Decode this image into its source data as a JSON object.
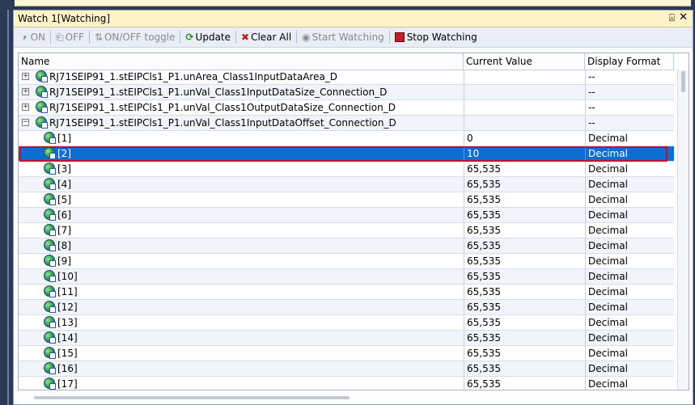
{
  "window": {
    "title": "Watch 1[Watching]",
    "pin": "⍓",
    "close": "✕"
  },
  "toolbar": {
    "on": "ON",
    "off": "OFF",
    "toggle": "ON/OFF toggle",
    "update": "Update",
    "clear_all": "Clear All",
    "start_watching": "Start Watching",
    "stop_watching": "Stop Watching"
  },
  "columns": {
    "name": "Name",
    "current_value": "Current Value",
    "display_format": "Display Format"
  },
  "rows": [
    {
      "name": "RJ71SEIP91_1.stEIPCls1_P1.unArea_Class1InputDataArea_D",
      "value": "",
      "format": "--",
      "expander": "+"
    },
    {
      "name": "RJ71SEIP91_1.stEIPCls1_P1.unVal_Class1InputDataSize_Connection_D",
      "value": "",
      "format": "--",
      "expander": "+"
    },
    {
      "name": "RJ71SEIP91_1.stEIPCls1_P1.unVal_Class1OutputDataSize_Connection_D",
      "value": "",
      "format": "--",
      "expander": "+"
    },
    {
      "name": "RJ71SEIP91_1.stEIPCls1_P1.unVal_Class1InputDataOffset_Connection_D",
      "value": "",
      "format": "--",
      "expander": "−"
    },
    {
      "name": "[1]",
      "value": "0",
      "format": "Decimal"
    },
    {
      "name": "[2]",
      "value": "10",
      "format": "Decimal"
    },
    {
      "name": "[3]",
      "value": "65,535",
      "format": "Decimal"
    },
    {
      "name": "[4]",
      "value": "65,535",
      "format": "Decimal"
    },
    {
      "name": "[5]",
      "value": "65,535",
      "format": "Decimal"
    },
    {
      "name": "[6]",
      "value": "65,535",
      "format": "Decimal"
    },
    {
      "name": "[7]",
      "value": "65,535",
      "format": "Decimal"
    },
    {
      "name": "[8]",
      "value": "65,535",
      "format": "Decimal"
    },
    {
      "name": "[9]",
      "value": "65,535",
      "format": "Decimal"
    },
    {
      "name": "[10]",
      "value": "65,535",
      "format": "Decimal"
    },
    {
      "name": "[11]",
      "value": "65,535",
      "format": "Decimal"
    },
    {
      "name": "[12]",
      "value": "65,535",
      "format": "Decimal"
    },
    {
      "name": "[13]",
      "value": "65,535",
      "format": "Decimal"
    },
    {
      "name": "[14]",
      "value": "65,535",
      "format": "Decimal"
    },
    {
      "name": "[15]",
      "value": "65,535",
      "format": "Decimal"
    },
    {
      "name": "[16]",
      "value": "65,535",
      "format": "Decimal"
    },
    {
      "name": "[17]",
      "value": "65,535",
      "format": "Decimal"
    }
  ]
}
